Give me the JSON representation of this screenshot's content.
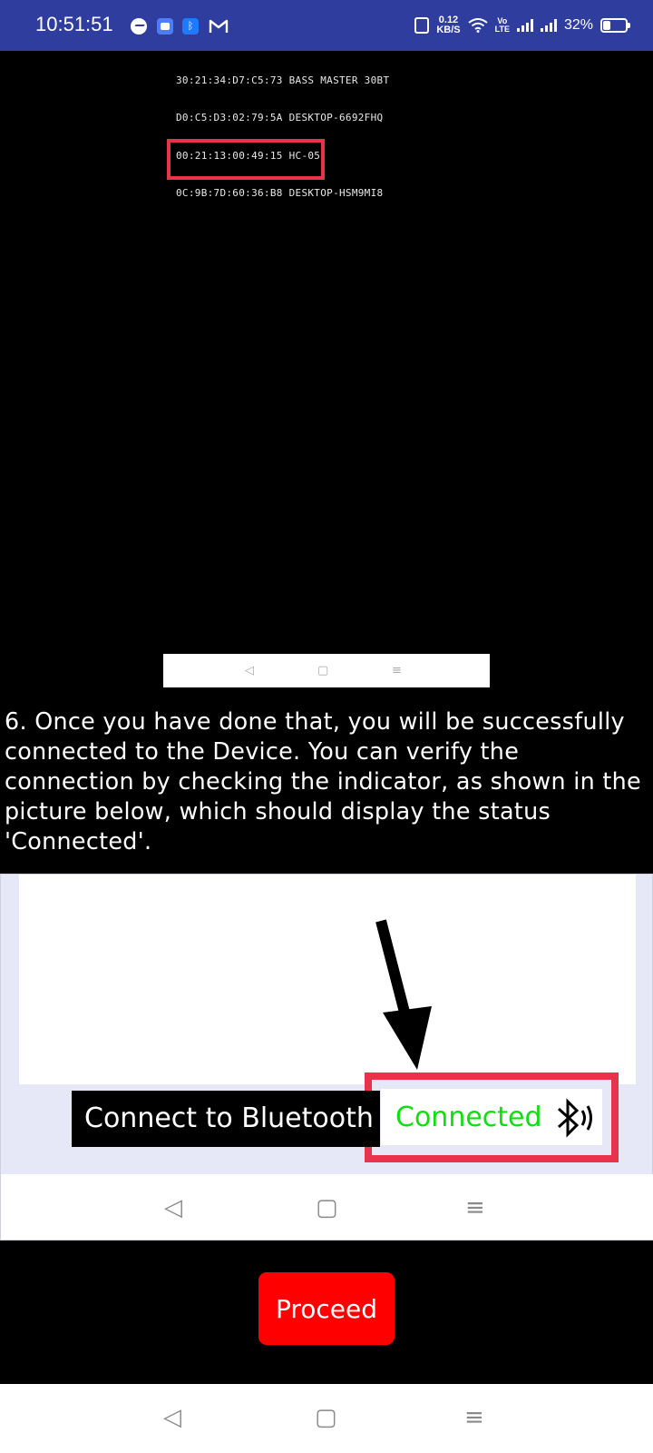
{
  "status_bar": {
    "time": "10:51:51",
    "network_speed_value": "0.12",
    "network_speed_unit": "KB/S",
    "volte_line1": "Vo",
    "volte_line2": "LTE",
    "battery": "32%",
    "notification_icons": [
      "messenger-icon",
      "app-icon",
      "bluetooth-icon",
      "gmail-icon"
    ],
    "system_icons": [
      "vibrate-icon",
      "wifi-icon",
      "volte-icon",
      "signal-icon",
      "signal-icon",
      "battery-icon"
    ],
    "background_color": "#2f3e9e"
  },
  "device_list": {
    "devices": [
      "30:21:34:D7:C5:73 BASS MASTER 30BT",
      "D0:C5:D3:02:79:5A DESKTOP-6692FHQ",
      "00:21:13:00:49:15 HC-05",
      "0C:9B:7D:60:36:B8 DESKTOP-HSM9MI8"
    ],
    "highlighted_device_index": 2,
    "highlight_color": "#e8334a"
  },
  "instruction": {
    "text": "6. Once you have done that, you will be successfully connected to the Device. You can verify the connection by checking the indicator, as shown in the picture below, which should display the status 'Connected'."
  },
  "example": {
    "connect_button_label": "Connect to Bluetooth",
    "status_label": "Connected",
    "status_color": "#11dd11",
    "arrow_icon": "arrow-down-icon",
    "bluetooth_icon": "bluetooth-icon"
  },
  "proceed_button": {
    "label": "Proceed",
    "color": "#ff0000"
  },
  "nav_icons": [
    "back-icon",
    "home-icon",
    "menu-icon"
  ]
}
